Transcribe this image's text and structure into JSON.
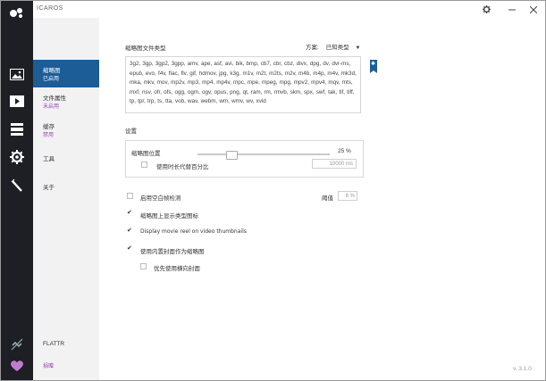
{
  "app": {
    "title": "ICAROS",
    "version": "v. 3.1.0"
  },
  "nav": [
    {
      "label": "缩略图",
      "status": "已启用"
    },
    {
      "label": "文件属性",
      "status": "未启用"
    },
    {
      "label": "缓存",
      "status": "禁用"
    },
    {
      "label": "工具",
      "status": ""
    },
    {
      "label": "关于",
      "status": ""
    }
  ],
  "footer": {
    "flattr": "FLATTR",
    "donate": "捐赠"
  },
  "thumbnails": {
    "filetypes_label": "缩略图文件类型",
    "scheme_label": "方案:",
    "scheme_value": "已知类型",
    "filetypes": "3g2, 3gp, 3gp2, 3gpp, amv, ape, asf, avi, bik, bmp, cb7, cbr, cbz, divx, dpg, dv, dvr-ms, epub, evo, f4v, flac, flv, gif, hdmov, jpg, k3g, m1v, m2t, m2ts, m2v, m4b, m4p, m4v, mk3d, mka, mkv, mov, mp2v, mp3, mp4, mp4v, mpc, mpe, mpeg, mpg, mpv2, mpv4, mqv, mts, mxf, nsv, ofr, ofs, ogg, ogm, ogv, opus, png, qt, ram, rm, rmvb, skm, spx, swf, tak, tif, tiff, tp, tpr, trp, ts, tta, vob, wav, webm, wm, wmv, wv, xvid"
  },
  "settings": {
    "title": "设置",
    "position_label": "缩略图位置",
    "position_percent": 25,
    "position_display": "25 %",
    "use_duration_label": "使用时长代替百分比",
    "use_duration_checked": false,
    "duration_ms": "10000 ms",
    "blank_detect_label": "启用空白帧检测",
    "blank_detect_checked": false,
    "threshold_label": "阈值",
    "threshold_value": "8 %",
    "show_icon_label": "缩略图上显示类型图标",
    "show_icon_checked": true,
    "movie_reel_label": "Display movie reel on video thumbnails",
    "movie_reel_checked": true,
    "embedded_cover_label": "使用内置封面作为缩略图",
    "embedded_cover_checked": true,
    "prefer_landscape_label": "优先使用横向封面",
    "prefer_landscape_checked": false
  },
  "icons": {
    "rail": [
      "image-icon",
      "video-play-icon",
      "stack-icon",
      "gear-icon",
      "pen-icon",
      "no-link-icon",
      "heart-icon"
    ]
  },
  "colors": {
    "accent": "#1c5d97",
    "purple": "#9b3fb5",
    "rail": "#1e1f24"
  }
}
